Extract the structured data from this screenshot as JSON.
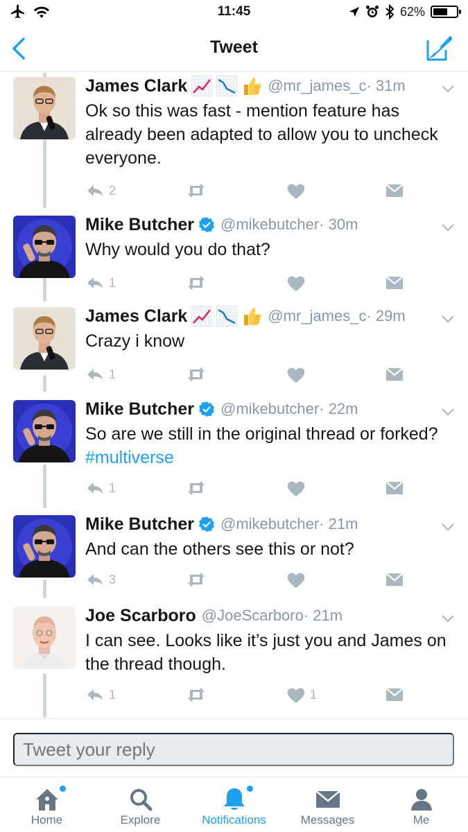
{
  "status_bar": {
    "time": "11:45",
    "battery": "62%",
    "battery_level": 0.62
  },
  "nav": {
    "title": "Tweet"
  },
  "tweets": [
    {
      "name": "James Clark",
      "emojis": [
        "chart-increasing",
        "chart-decreasing",
        "thumbs-up"
      ],
      "verified": false,
      "handle": "@mr_james_c",
      "time": "· 31m",
      "text": "Ok so this was fast - mention feature has already been adapted to allow you to uncheck everyone.",
      "hashtag": "",
      "reply_count": "2",
      "like_count": "",
      "avatar": "james"
    },
    {
      "name": "Mike Butcher",
      "emojis": [],
      "verified": true,
      "handle": "@mikebutcher",
      "time": "· 30m",
      "text": "Why would you do that?",
      "hashtag": "",
      "reply_count": "1",
      "like_count": "",
      "avatar": "mike"
    },
    {
      "name": "James Clark",
      "emojis": [
        "chart-increasing",
        "chart-decreasing",
        "thumbs-up"
      ],
      "verified": false,
      "handle": "@mr_james_c",
      "time": "· 29m",
      "text": "Crazy i know",
      "hashtag": "",
      "reply_count": "1",
      "like_count": "",
      "avatar": "james"
    },
    {
      "name": "Mike Butcher",
      "emojis": [],
      "verified": true,
      "handle": "@mikebutcher",
      "time": "· 22m",
      "text": "So are we still in the original thread or forked? ",
      "hashtag": "#multiverse",
      "reply_count": "1",
      "like_count": "",
      "avatar": "mike"
    },
    {
      "name": "Mike Butcher",
      "emojis": [],
      "verified": true,
      "handle": "@mikebutcher",
      "time": "· 21m",
      "text": "And can the others see this or not?",
      "hashtag": "",
      "reply_count": "3",
      "like_count": "",
      "avatar": "mike"
    },
    {
      "name": "Joe Scarboro",
      "emojis": [],
      "verified": false,
      "handle": "@JoeScarboro",
      "time": "· 21m",
      "text": "I can see. Looks like it’s just you and James on the thread though.",
      "hashtag": "",
      "reply_count": "1",
      "like_count": "1",
      "avatar": "joe"
    }
  ],
  "reply": {
    "placeholder": "Tweet your reply"
  },
  "tabs": [
    {
      "label": "Home",
      "icon": "home-icon",
      "dot": true,
      "active": false
    },
    {
      "label": "Explore",
      "icon": "search-icon",
      "dot": false,
      "active": false
    },
    {
      "label": "Notifications",
      "icon": "bell-icon",
      "dot": true,
      "active": true
    },
    {
      "label": "Messages",
      "icon": "envelope-icon",
      "dot": false,
      "active": false
    },
    {
      "label": "Me",
      "icon": "person-icon",
      "dot": false,
      "active": false
    }
  ],
  "colors": {
    "accent": "#1da1f2",
    "muted": "#8899a6",
    "icon": "#aab8c2",
    "thread": "#ccd6dd",
    "text": "#14171a"
  }
}
